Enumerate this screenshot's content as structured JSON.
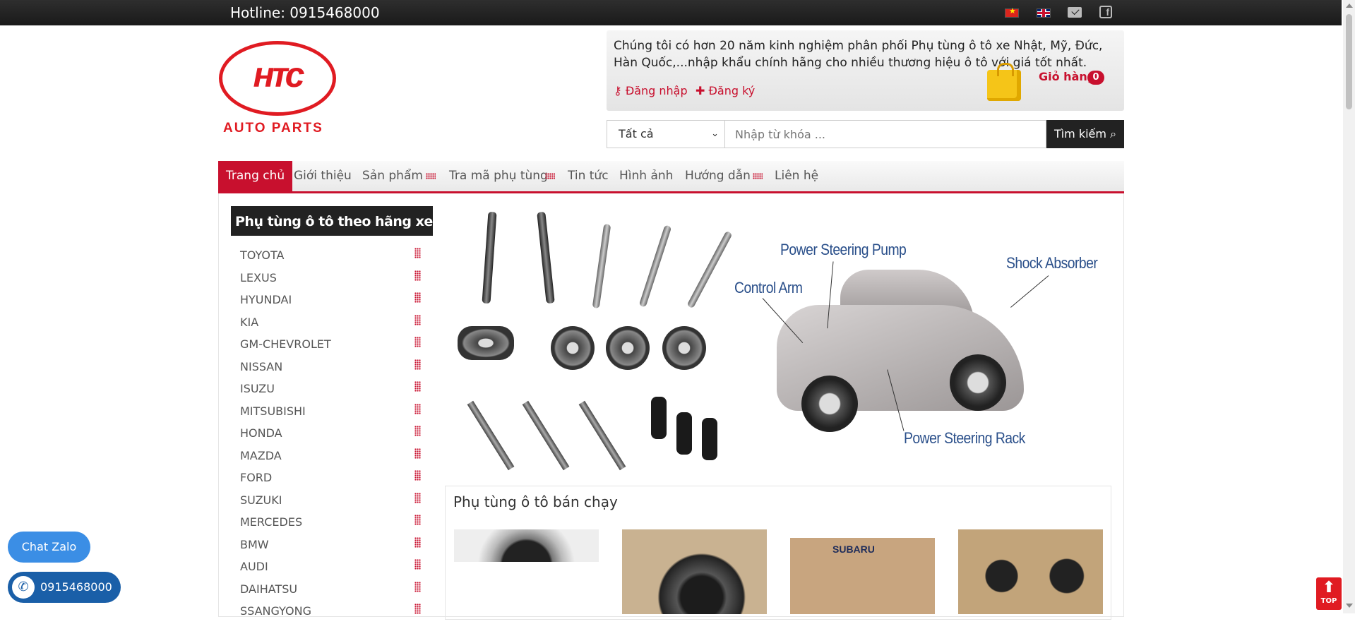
{
  "topbar": {
    "hotline": "Hotline: 0915468000",
    "icons": [
      "flag-vietnam-icon",
      "flag-uk-icon",
      "mail-icon",
      "facebook-icon"
    ]
  },
  "logo": {
    "text": "AUTO PARTS"
  },
  "header": {
    "intro": "Chúng tôi có hơn 20 năm kinh nghiệm phân phối Phụ tùng ô tô xe Nhật, Mỹ, Đức, Hàn Quốc,...nhập khẩu chính hãng cho nhiều thương hiệu ô tô với giá tốt nhất.",
    "login": "Đăng nhập",
    "register": "Đăng ký",
    "cart_label": "Giỏ hàng",
    "cart_count": "0"
  },
  "search": {
    "category": "Tất cả",
    "placeholder": "Nhập từ khóa ...",
    "button": "Tìm kiếm"
  },
  "nav": {
    "items": [
      "Trang chủ",
      "Giới thiệu",
      "Sản phẩm",
      "Tra mã phụ tùng",
      "Tin tức",
      "Hình ảnh",
      "Hướng dẫn",
      "Liên hệ"
    ],
    "active": "Trang chủ"
  },
  "sidebar": {
    "title": "Phụ tùng ô tô theo hãng xe",
    "brands": [
      "TOYOTA",
      "LEXUS",
      "HYUNDAI",
      "KIA",
      "GM-CHEVROLET",
      "NISSAN",
      "ISUZU",
      "MITSUBISHI",
      "HONDA",
      "MAZDA",
      "FORD",
      "SUZUKI",
      "MERCEDES",
      "BMW",
      "AUDI",
      "DAIHATSU",
      "SSANGYONG"
    ]
  },
  "banner": {
    "callouts": [
      "Power Steering Pump",
      "Shock Absorber",
      "Control Arm",
      "Power Steering Rack"
    ]
  },
  "bestsellers": {
    "title": "Phụ tùng ô tô bán chạy"
  },
  "floating": {
    "chat_zalo": "Chat Zalo",
    "phone": "0915468000",
    "top": "TOP"
  },
  "colors": {
    "brand_red": "#c8102e",
    "topbar": "#222222",
    "zalo_blue": "#3b8ee5"
  }
}
